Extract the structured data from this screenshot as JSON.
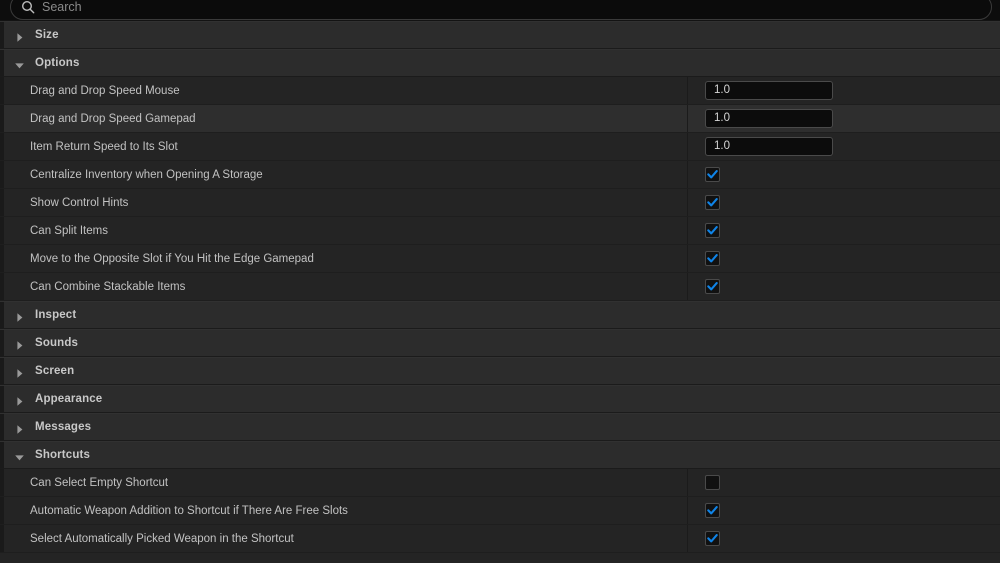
{
  "panel": {
    "title": "Details Panel",
    "accent_color": "#0f84e8",
    "row_bg": "#242424",
    "category_bg": "#2c2c2c"
  },
  "search": {
    "placeholder": "Search",
    "value": "",
    "icon": "search-icon"
  },
  "sections": [
    {
      "label": "Size",
      "expanded": false,
      "arrow_icon": "triangle-right-icon",
      "rows": []
    },
    {
      "label": "Options",
      "expanded": true,
      "arrow_icon": "triangle-down-icon",
      "rows": [
        {
          "label": "Drag and Drop Speed Mouse",
          "type": "number",
          "value": "1.0",
          "hovered": false
        },
        {
          "label": "Drag and Drop Speed Gamepad",
          "type": "number",
          "value": "1.0",
          "hovered": true
        },
        {
          "label": "Item Return Speed to Its Slot",
          "type": "number",
          "value": "1.0",
          "hovered": false
        },
        {
          "label": "Centralize Inventory when Opening A Storage",
          "type": "checkbox",
          "checked": true,
          "hovered": false
        },
        {
          "label": "Show Control Hints",
          "type": "checkbox",
          "checked": true,
          "hovered": false
        },
        {
          "label": "Can Split Items",
          "type": "checkbox",
          "checked": true,
          "hovered": false
        },
        {
          "label": "Move to the Opposite Slot if You Hit the Edge Gamepad",
          "type": "checkbox",
          "checked": true,
          "hovered": false
        },
        {
          "label": "Can Combine Stackable Items",
          "type": "checkbox",
          "checked": true,
          "hovered": false
        }
      ]
    },
    {
      "label": "Inspect",
      "expanded": false,
      "arrow_icon": "triangle-right-icon",
      "rows": []
    },
    {
      "label": "Sounds",
      "expanded": false,
      "arrow_icon": "triangle-right-icon",
      "rows": []
    },
    {
      "label": "Screen",
      "expanded": false,
      "arrow_icon": "triangle-right-icon",
      "rows": []
    },
    {
      "label": "Appearance",
      "expanded": false,
      "arrow_icon": "triangle-right-icon",
      "rows": []
    },
    {
      "label": "Messages",
      "expanded": false,
      "arrow_icon": "triangle-right-icon",
      "rows": []
    },
    {
      "label": "Shortcuts",
      "expanded": true,
      "arrow_icon": "triangle-down-icon",
      "rows": [
        {
          "label": "Can Select Empty Shortcut",
          "type": "checkbox",
          "checked": false,
          "hovered": false
        },
        {
          "label": "Automatic Weapon Addition to Shortcut if There Are Free Slots",
          "type": "checkbox",
          "checked": true,
          "hovered": false
        },
        {
          "label": "Select Automatically Picked Weapon in the Shortcut",
          "type": "checkbox",
          "checked": true,
          "hovered": false
        }
      ]
    }
  ]
}
